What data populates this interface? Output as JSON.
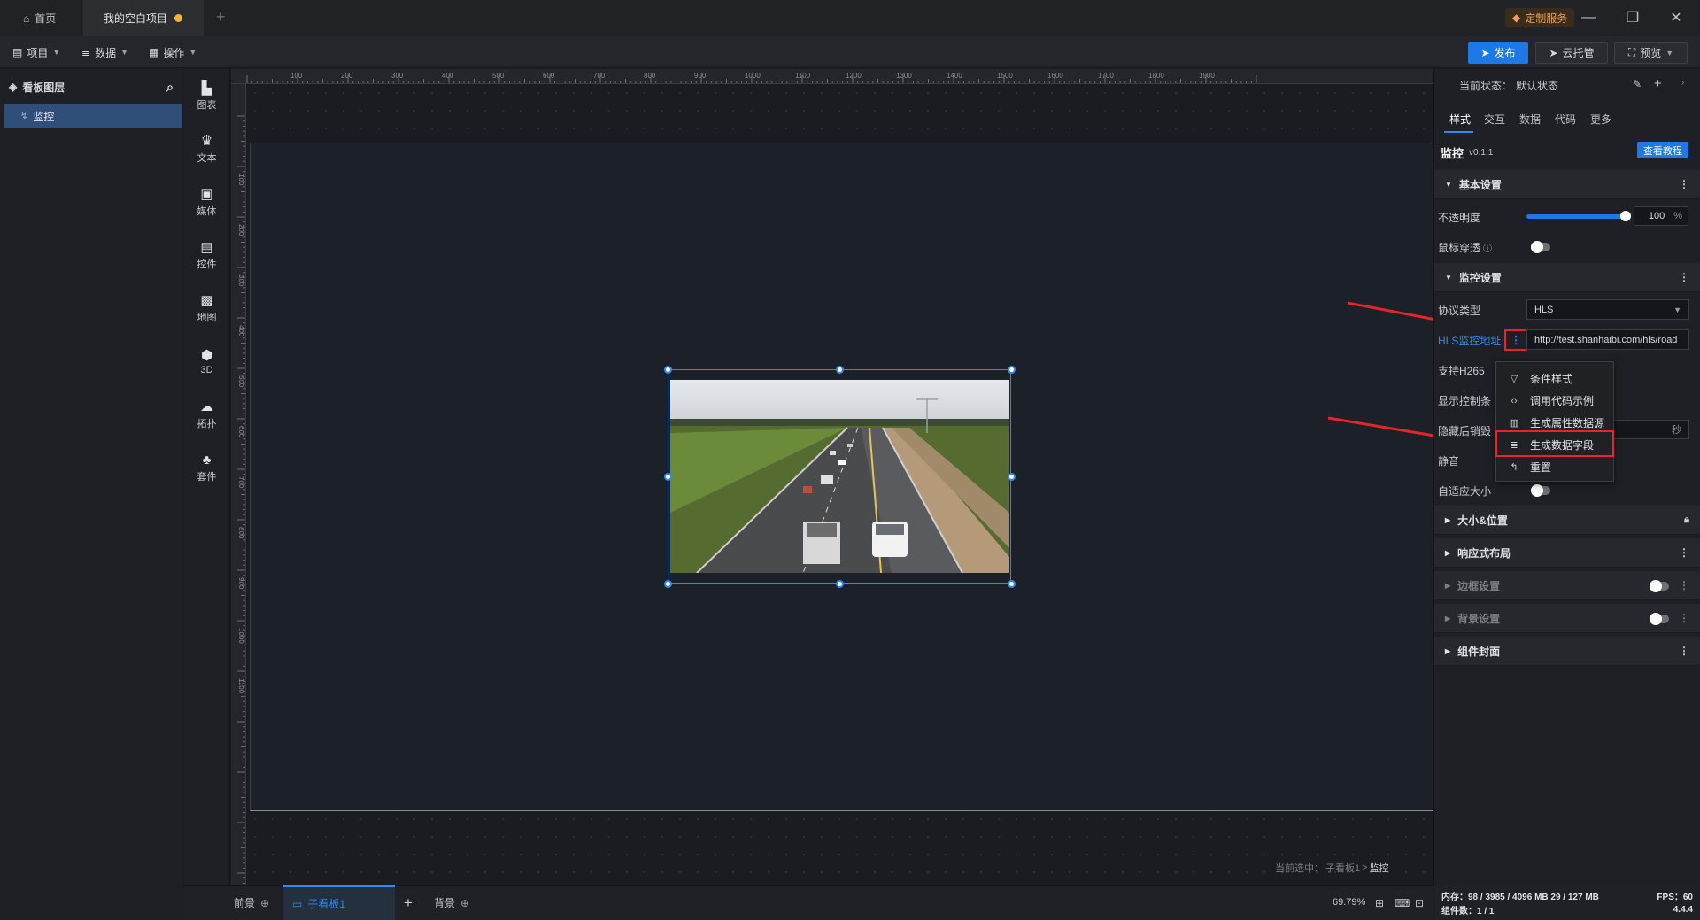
{
  "titlebar": {
    "home_tab": "首页",
    "project_tab": "我的空白项目",
    "custom_service": "定制服务",
    "minimize": "—",
    "restore": "❐",
    "close": "✕"
  },
  "menubar": {
    "items": [
      "项目",
      "数据",
      "操作"
    ],
    "publish": "发布",
    "cloud": "云托管",
    "preview": "预览"
  },
  "layers": {
    "title": "看板图层",
    "items": [
      {
        "label": "监控"
      }
    ]
  },
  "toolbar": {
    "items": [
      {
        "label": "图表",
        "icon": "bar-chart-icon"
      },
      {
        "label": "文本",
        "icon": "text-icon"
      },
      {
        "label": "媒体",
        "icon": "media-icon"
      },
      {
        "label": "控件",
        "icon": "control-icon"
      },
      {
        "label": "地图",
        "icon": "map-icon"
      },
      {
        "label": "3D",
        "icon": "cube-icon"
      },
      {
        "label": "拓扑",
        "icon": "topology-icon"
      },
      {
        "label": "套件",
        "icon": "shirt-icon"
      }
    ]
  },
  "ruler": {
    "top_labels": [
      "100",
      "200",
      "300",
      "400",
      "500",
      "600",
      "700",
      "800",
      "900",
      "1000",
      "1100",
      "1200",
      "1300",
      "1400",
      "1500",
      "1600",
      "1700",
      "1800",
      "1900"
    ],
    "left_labels": [
      "100",
      "200",
      "300",
      "400",
      "500",
      "600",
      "700",
      "800",
      "900",
      "1000",
      "1100"
    ]
  },
  "canvas": {
    "status_prefix": "当前选中：",
    "status_path": "子看板1",
    "status_sep": " > ",
    "status_current": "监控"
  },
  "bottombar": {
    "tabs": [
      {
        "label": "前景"
      },
      {
        "label": "子看板1"
      },
      {
        "label": "背景"
      }
    ],
    "add": "+",
    "zoom": "69.79%"
  },
  "panel": {
    "state_label": "当前状态：",
    "state_value": "默认状态",
    "tabs": [
      "样式",
      "交互",
      "数据",
      "代码",
      "更多"
    ],
    "component_name": "监控",
    "component_version": "v0.1.1",
    "tutorial_button": "查看教程",
    "sections": {
      "basic": "基本设置",
      "monitor": "监控设置",
      "size": "大小&位置",
      "responsive": "响应式布局",
      "border": "边框设置",
      "background": "背景设置",
      "cover": "组件封面"
    },
    "opacity_label": "不透明度",
    "opacity_value": "100",
    "opacity_unit": "%",
    "opacity_fraction": 1.0,
    "mouse_pass_label": "鼠标穿透",
    "protocol_label": "协议类型",
    "protocol_value": "HLS",
    "hls_label": "HLS监控地址",
    "hls_value": "http://test.shanhaibi.com/hls/road",
    "h265_label": "支持H265",
    "controls_label": "显示控制条",
    "hide_destroy_label": "隐藏后销毁",
    "seconds_unit": "秒",
    "mute_label": "静音",
    "autosize_label": "自适应大小"
  },
  "context_menu": {
    "items": [
      {
        "label": "条件样式",
        "icon": "filter-icon"
      },
      {
        "label": "调用代码示例",
        "icon": "code-icon"
      },
      {
        "label": "生成属性数据源",
        "icon": "chart-icon"
      },
      {
        "label": "生成数据字段",
        "icon": "database-icon"
      },
      {
        "label": "重置",
        "icon": "reset-icon"
      }
    ]
  },
  "status": {
    "memory": "内存：98 / 3985 / 4096 MB  29 / 127 MB",
    "fps": "FPS：60",
    "components": "组件数：1 / 1",
    "version": "4.4.4"
  },
  "colors": {
    "accent": "#1e78e6",
    "highlight_red": "#e5252a",
    "unsaved_dot": "#f0b33a"
  }
}
